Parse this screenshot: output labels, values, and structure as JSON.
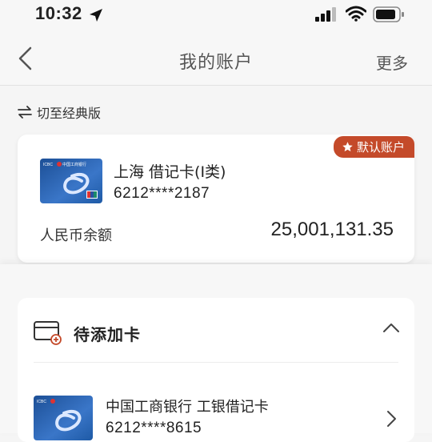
{
  "status_bar": {
    "time": "10:32"
  },
  "header": {
    "title": "我的账户",
    "more_label": "更多"
  },
  "switch_view": {
    "label": "切至经典版"
  },
  "account_card": {
    "badge": "默认账户",
    "name": "上海 借记卡(Ⅰ类)",
    "number": "6212****2187",
    "balance_label": "人民币余额",
    "balance": "25,001,131.35",
    "card_brand_text": "中国工商银行"
  },
  "pending_section": {
    "title": "待添加卡",
    "items": [
      {
        "name": "中国工商银行 工银借记卡",
        "number": "6212****8615"
      }
    ]
  },
  "colors": {
    "badge": "#c44a2a",
    "card_blue": "#1f5ea8",
    "background": "#f5f5f5"
  }
}
